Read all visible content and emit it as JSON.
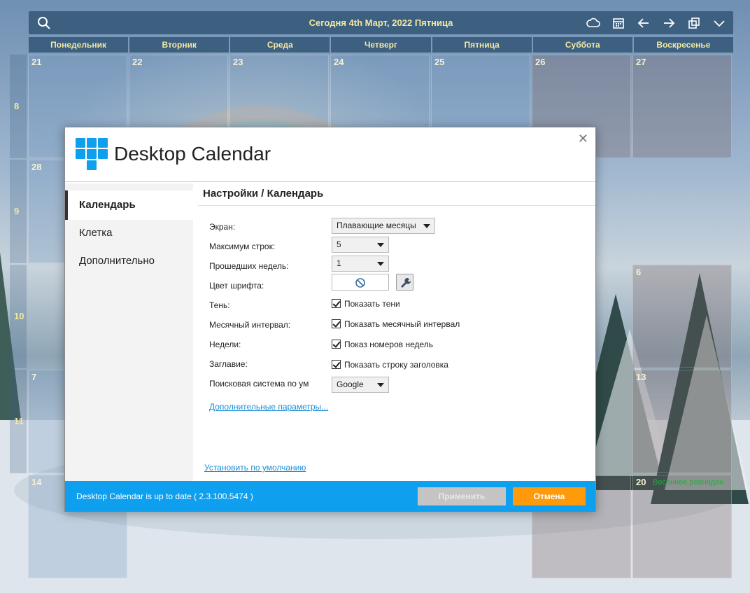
{
  "toolbar": {
    "title": "Сегодня 4th Март, 2022 Пятница",
    "icons": [
      "search-icon",
      "cloud-icon",
      "calendar-icon",
      "arrow-left-icon",
      "arrow-right-icon",
      "copy-icon",
      "chevron-down-icon"
    ]
  },
  "weekdays": [
    "Понедельник",
    "Вторник",
    "Среда",
    "Четверг",
    "Пятница",
    "Суббота",
    "Воскресенье"
  ],
  "weeks": [
    {
      "num": "8",
      "days": [
        "21",
        "22",
        "23",
        "24",
        "25",
        "26",
        "27"
      ]
    },
    {
      "num": "9",
      "days": [
        "28",
        "",
        "",
        "",
        "",
        "",
        "6"
      ]
    },
    {
      "num": "10",
      "days": [
        "7",
        "",
        "",
        "",
        "",
        "",
        "13"
      ]
    },
    {
      "num": "11",
      "days": [
        "14",
        "",
        "",
        "",
        "",
        "",
        "20"
      ]
    }
  ],
  "events": {
    "spring_equinox": "Весеннее равноден"
  },
  "dialog": {
    "title": "Desktop Calendar",
    "sidebar": [
      "Календарь",
      "Клетка",
      "Дополнительно"
    ],
    "content_title": "Настройки / Календарь",
    "labels": {
      "screen": "Экран:",
      "max_rows": "Максимум строк:",
      "past_weeks": "Прошедших недель:",
      "font_color": "Цвет шрифта:",
      "shadow": "Тень:",
      "month_interval": "Месячный интервал:",
      "weeks": "Недели:",
      "title": "Заглавие:",
      "search": "Поисковая система по ум"
    },
    "values": {
      "screen": "Плавающие месяцы",
      "max_rows": "5",
      "past_weeks": "1",
      "search": "Google"
    },
    "checkboxes": {
      "shadow": "Показать тени",
      "month_interval": "Показать месячный интервал",
      "weeks": "Показ номеров недель",
      "title": "Показать строку заголовка"
    },
    "advanced_link": "Дополнительные параметры...",
    "reset_link": "Установить по умолчанию",
    "status": "Desktop Calendar is up to date ( 2.3.100.5474 )",
    "apply": "Применить",
    "cancel": "Отмена"
  }
}
